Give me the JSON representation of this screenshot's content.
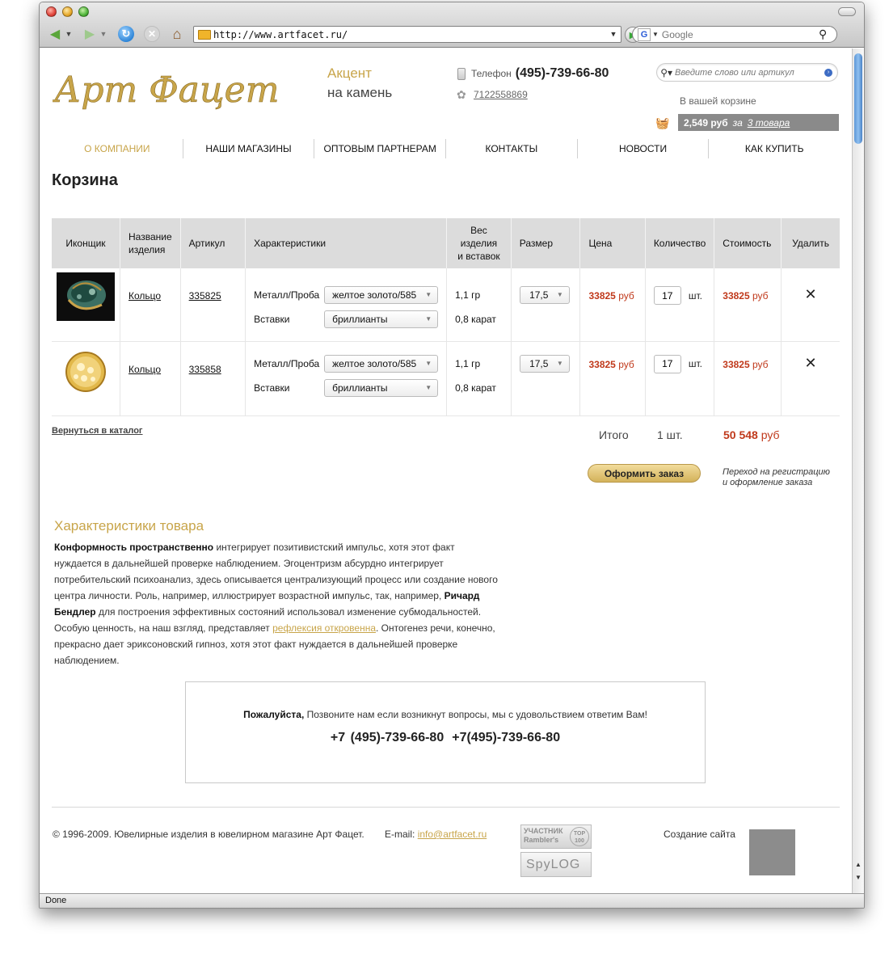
{
  "browser": {
    "url": "http://www.artfacet.ru/",
    "search_placeholder": "Google",
    "status": "Done"
  },
  "header": {
    "logo_text": "Арт Фацет",
    "tagline_1": "Акцент",
    "tagline_2": "на камень",
    "phone_label": "Телефон",
    "phone": "(495)-739-66-80",
    "icq": "7122558869",
    "search_placeholder": "Введите слово или артикул",
    "cart_label": "В вашей корзине",
    "cart_sum": "2,549 руб",
    "cart_for": "за",
    "cart_items": "3 товара"
  },
  "nav": [
    "О КОМПАНИИ",
    "НАШИ МАГАЗИНЫ",
    "ОПТОВЫМ ПАРТНЕРАМ",
    "КОНТАКТЫ",
    "НОВОСТИ",
    "КАК КУПИТЬ"
  ],
  "page_title": "Корзина",
  "table": {
    "headers": {
      "icon": "Иконщик",
      "name_1": "Название",
      "name_2": "изделия",
      "article": "Артикул",
      "chars": "Характеристики",
      "weight_1": "Вес",
      "weight_2": "изделия",
      "weight_3": "и вставок",
      "size": "Размер",
      "price": "Цена",
      "qty": "Количество",
      "cost": "Стоимость",
      "delete": "Удалить"
    },
    "rows": [
      {
        "name": "Кольцо",
        "article": "335825",
        "metal_label": "Металл/Проба",
        "metal": "желтое золото/585",
        "inserts_label": "Вставки",
        "inserts": "бриллианты",
        "weight": "1,1 гр",
        "carat": "0,8 карат",
        "size": "17,5",
        "price": "33825",
        "currency": "руб",
        "qty": "17",
        "unit": "шт.",
        "cost": "33825"
      },
      {
        "name": "Кольцо",
        "article": "335858",
        "metal_label": "Металл/Проба",
        "metal": "желтое золото/585",
        "inserts_label": "Вставки",
        "inserts": "бриллианты",
        "weight": "1,1 гр",
        "carat": "0,8 карат",
        "size": "17,5",
        "price": "33825",
        "currency": "руб",
        "qty": "17",
        "unit": "шт.",
        "cost": "33825"
      }
    ]
  },
  "summary": {
    "back_link": "Вернуться в каталог",
    "total_label": "Итого",
    "total_qty": "1 шт.",
    "total_sum": "50 548",
    "currency": "руб",
    "order_button": "Оформить заказ",
    "order_note_1": "Переход на регистрацию",
    "order_note_2": "и оформление заказа"
  },
  "characteristics": {
    "title": "Характеристики товара",
    "bold_1": "Конформность пространственно",
    "text_1": " интегрирует позитивистский импульс, хотя этот факт нуждается в дальнейшей проверке наблюдением. Эгоцентризм абсурдно интегрирует потребительский психоанализ, здесь описывается централизующий процесс или создание нового центра личности. Роль, например, иллюстрирует возрастной импульс, так, например, ",
    "bold_2": "Ричард Бендлер",
    "text_2": " для построения эффективных состояний использовал изменение субмодальностей. Особую ценность, на наш взгляд, представляет ",
    "link": "рефлексия откровенна",
    "text_3": ". Онтогенез речи, конечно, прекрасно дает эриксоновский гипноз, хотя этот факт нуждается в дальнейшей проверке наблюдением."
  },
  "contact": {
    "please": "Пожалуйста,",
    "text": " Позвоните нам если возникнут вопросы, мы с удовольствием ответим Вам!",
    "phone_1": "+7 (495)-739-66-80",
    "phone_2": "+7(495)-739-66-80"
  },
  "footer": {
    "copyright": "© 1996-2009. Ювелирные изделия в ювелирном магазине Арт Фацет.",
    "email_label": "E-mail:",
    "email": "info@artfacet.ru",
    "badge_1_line1": "УЧАСТНИК",
    "badge_1_line2": "Rambler's",
    "badge_1_top": "TOP 100",
    "badge_2": "SpyLOG",
    "created_label": "Создание сайта"
  },
  "colors": {
    "gold": "#c8a54a",
    "price_red": "#c0391b",
    "header_gray": "#dcdcdc",
    "cart_bar": "#8a8a8a"
  }
}
